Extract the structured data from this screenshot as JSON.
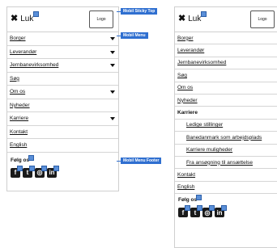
{
  "close_label": "Luk",
  "logo_label": "Logo",
  "callouts": {
    "sticky_top": "Mobil Sticky Top",
    "menu": "Mobil Menu",
    "footer": "Mobil Menu Footer"
  },
  "left_menu": [
    {
      "label": "Borger",
      "chevron": true
    },
    {
      "label": "Leverandør",
      "chevron": true
    },
    {
      "label": "Jernbanevirksomhed",
      "chevron": true
    },
    {
      "label": "Søg",
      "chevron": false
    },
    {
      "label": "Om os",
      "chevron": true
    },
    {
      "label": "Nyheder",
      "chevron": false
    },
    {
      "label": "Karriere",
      "chevron": true
    },
    {
      "label": "Kontakt",
      "chevron": false
    },
    {
      "label": "English",
      "chevron": false
    }
  ],
  "right_menu": [
    {
      "label": "Borger"
    },
    {
      "label": "Leverandør"
    },
    {
      "label": "Jernbanevirksomhed"
    },
    {
      "label": "Søg"
    },
    {
      "label": "Om os"
    },
    {
      "label": "Nyheder"
    },
    {
      "label": "Karriere",
      "bold": true
    },
    {
      "label": "Ledige stillinger",
      "sub": true
    },
    {
      "label": "Banedanmark som arbejdsplads",
      "sub": true
    },
    {
      "label": "Karriere muligheder",
      "sub": true
    },
    {
      "label": "Fra ansøgning til ansættelse",
      "sub": true
    },
    {
      "label": "Kontakt"
    },
    {
      "label": "English"
    }
  ],
  "footer": {
    "follow_label": "Følg os",
    "social": [
      {
        "icon": "facebook-icon",
        "glyph": "f"
      },
      {
        "icon": "twitter-icon",
        "glyph": "t"
      },
      {
        "icon": "instagram-icon",
        "glyph": "◎"
      },
      {
        "icon": "linkedin-icon",
        "glyph": "in"
      }
    ]
  }
}
